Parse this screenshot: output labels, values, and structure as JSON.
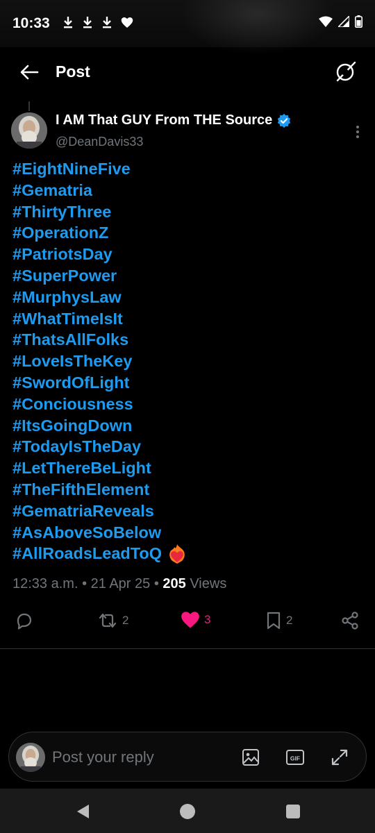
{
  "status_bar": {
    "time": "10:33"
  },
  "header": {
    "title": "Post"
  },
  "author": {
    "name": "I AM That GUY From THE Source",
    "handle": "@DeanDavis33",
    "verified_color": "#1d9bf0"
  },
  "tweet": {
    "hashtags": [
      "#EightNineFive",
      "#Gematria",
      "#ThirtyThree",
      "#OperationZ",
      "#PatriotsDay",
      "#SuperPower",
      "#MurphysLaw",
      "#WhatTimeIsIt",
      "#ThatsAllFolks",
      "#LoveIsTheKey",
      "#SwordOfLight",
      "#Conciousness",
      "#ItsGoingDown",
      "#TodayIsTheDay",
      "#LetThereBeLight",
      "#TheFifthElement",
      "#GematriaReveals",
      "#AsAboveSoBelow",
      "#AllRoadsLeadToQ"
    ],
    "trailing_emoji": "heart-on-fire-emoji",
    "time": "12:33 a.m.",
    "date": "21 Apr 25",
    "views_count": "205",
    "views_label": "Views"
  },
  "actions": {
    "reposts": "2",
    "likes": "3",
    "bookmarks": "2",
    "like_color": "#f91880"
  },
  "reply": {
    "placeholder": "Post your reply"
  },
  "colors": {
    "accent": "#1d9bf0",
    "background": "#000000",
    "muted": "#71767b"
  }
}
